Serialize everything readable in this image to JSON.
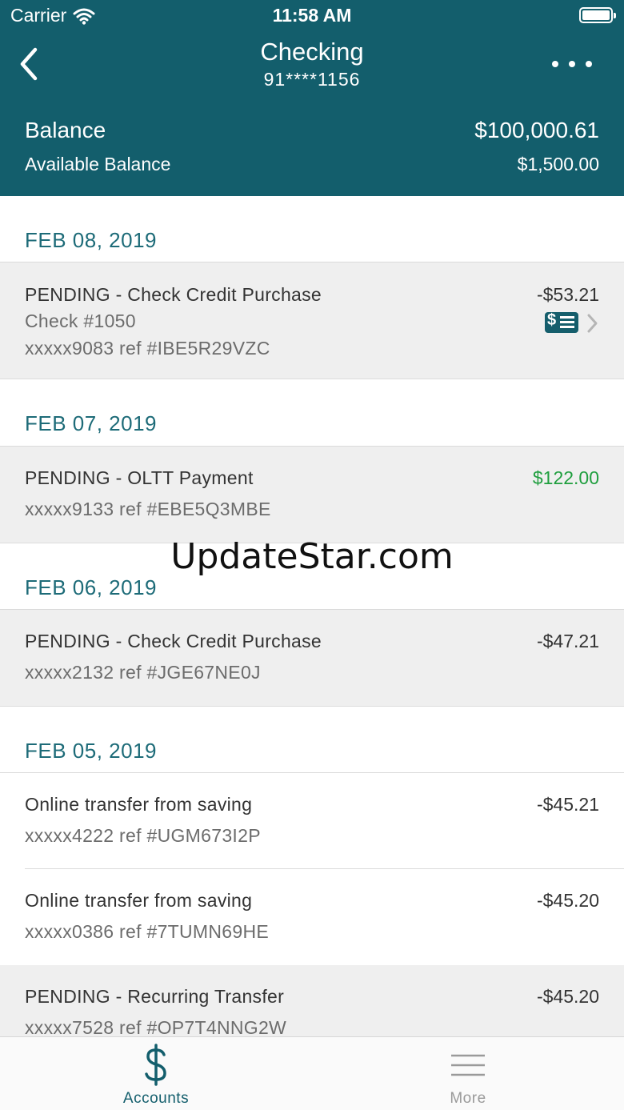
{
  "status_bar": {
    "carrier": "Carrier",
    "time": "11:58 AM"
  },
  "nav": {
    "title": "Checking",
    "subtitle": "91****1156"
  },
  "summary": {
    "balance_label": "Balance",
    "balance_value": "$100,000.61",
    "available_label": "Available Balance",
    "available_value": "$1,500.00"
  },
  "groups": [
    {
      "date": "FEB 08, 2019",
      "transactions": [
        {
          "description": "PENDING - Check Credit Purchase",
          "detail": "Check #1050",
          "reference": "xxxxx9083 ref #IBE5R29VZC",
          "amount": "-$53.21"
        }
      ]
    },
    {
      "date": "FEB 07, 2019",
      "transactions": [
        {
          "description": "PENDING - OLTT Payment",
          "reference": "xxxxx9133 ref #EBE5Q3MBE",
          "amount": "$122.00"
        }
      ]
    },
    {
      "date": "FEB 06, 2019",
      "transactions": [
        {
          "description": "PENDING - Check Credit Purchase",
          "reference": "xxxxx2132 ref #JGE67NE0J",
          "amount": "-$47.21"
        }
      ]
    },
    {
      "date": "FEB 05, 2019",
      "transactions": [
        {
          "description": "Online transfer from saving",
          "reference": "xxxxx4222 ref #UGM673I2P",
          "amount": "-$45.21"
        },
        {
          "description": "Online transfer from saving",
          "reference": "xxxxx0386 ref #7TUMN69HE",
          "amount": "-$45.20"
        },
        {
          "description": "PENDING - Recurring Transfer",
          "reference": "xxxxx7528 ref #OP7T4NNG2W",
          "amount": "-$45.20"
        }
      ]
    }
  ],
  "watermark": "UpdateStar.com",
  "tabs": {
    "accounts": "Accounts",
    "more": "More"
  },
  "colors": {
    "header": "#135e6c",
    "accent": "#1d6b78",
    "credit": "#1f9e3e",
    "pending_row": "#efefef"
  },
  "icons": {
    "back": "chevron-left-icon",
    "more": "ellipsis-icon",
    "check": "check-image-icon",
    "accounts": "dollar-icon",
    "more_tab": "hamburger-icon"
  }
}
